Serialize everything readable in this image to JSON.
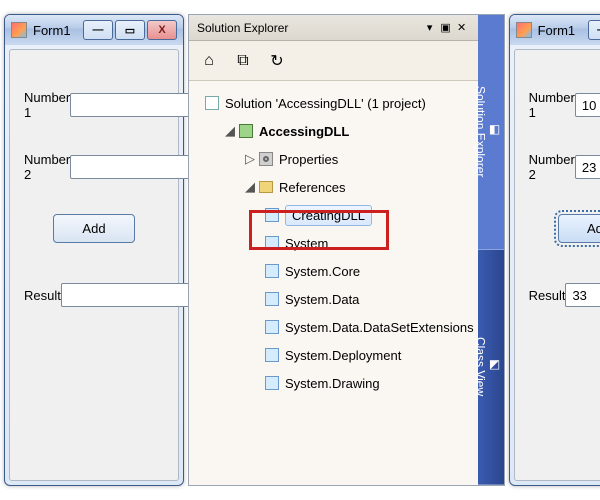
{
  "form_left": {
    "title": "Form1",
    "labels": {
      "n1": "Number 1",
      "n2": "Number 2",
      "result": "Result"
    },
    "values": {
      "n1": "",
      "n2": "",
      "result": ""
    },
    "add_label": "Add"
  },
  "form_right": {
    "title": "Form1",
    "labels": {
      "n1": "Number 1",
      "n2": "Number 2",
      "result": "Result"
    },
    "values": {
      "n1": "10",
      "n2": "23",
      "result": "33"
    },
    "add_label": "Add"
  },
  "window_buttons": {
    "min": "—",
    "max": "▭",
    "close": "X"
  },
  "sln": {
    "panel_title": "Solution Explorer",
    "head_controls": {
      "menu": "▾",
      "pin": "▣",
      "close": "✕"
    },
    "toolbar_icons": {
      "home": "⌂",
      "showall": "⧉",
      "refresh": "↻"
    },
    "tree": {
      "solution": "Solution 'AccessingDLL' (1 project)",
      "project": "AccessingDLL",
      "properties": "Properties",
      "references": "References",
      "refs": {
        "creatingdll": "CreatingDLL",
        "system": "System",
        "system_core": "System.Core",
        "system_data": "System.Data",
        "system_data_ext": "System.Data.DataSetExtensions",
        "system_deployment": "System.Deployment",
        "system_drawing": "System.Drawing"
      }
    },
    "vtabs": {
      "solution_explorer": "Solution Explorer",
      "class_view": "Class View"
    }
  }
}
